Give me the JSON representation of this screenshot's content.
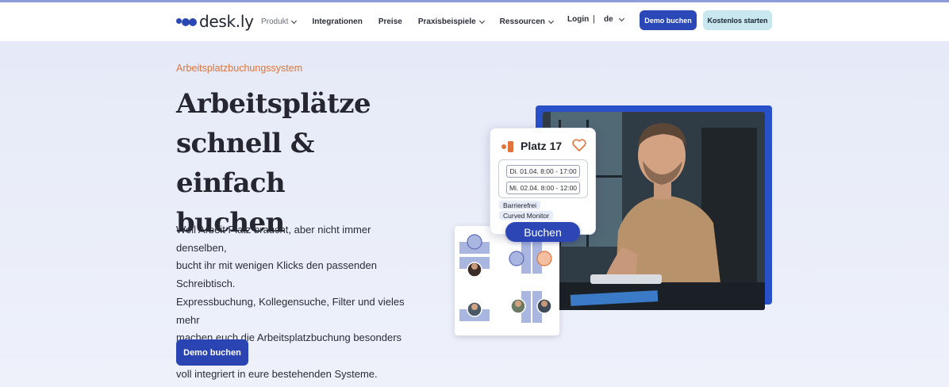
{
  "brand": {
    "name": "desk.ly",
    "color": "#2a47b6"
  },
  "nav": {
    "items": [
      {
        "label": "Produkt",
        "dropdown": true,
        "muted": true
      },
      {
        "label": "Integrationen",
        "dropdown": false
      },
      {
        "label": "Preise",
        "dropdown": false
      },
      {
        "label": "Praxisbeispiele",
        "dropdown": true
      },
      {
        "label": "Ressourcen",
        "dropdown": true
      }
    ],
    "login": "Login",
    "separator": "|",
    "language": "de",
    "demo_button": "Demo buchen",
    "free_button": "Kostenlos starten"
  },
  "hero": {
    "eyebrow": "Arbeitsplatzbuchungssystem",
    "title_lines": [
      "Arbeitsplätze",
      "schnell & einfach",
      "buchen"
    ],
    "lead_lines": [
      "Weil Arbeit Platz braucht, aber nicht immer denselben,",
      "bucht ihr mit wenigen Klicks den passenden Schreibtisch.",
      "Expressbuchung, Kollegensuche, Filter und vieles mehr",
      "machen euch die Arbeitsplatzbuchung besonders leicht –",
      "voll integriert in eure bestehenden Systeme."
    ],
    "cta": "Demo buchen"
  },
  "booking_card": {
    "title": "Platz 17",
    "slots": [
      "Di. 01.04.  8:00 - 17:00",
      "Mi. 02.04.  8:00 - 12:00"
    ],
    "tags": [
      "Barrierefrei",
      "Curved Monitor"
    ],
    "button": "Buchen"
  },
  "colors": {
    "accent_orange": "#e0743a",
    "primary_blue": "#2b48b9",
    "light_cyan": "#c9e7ef"
  }
}
